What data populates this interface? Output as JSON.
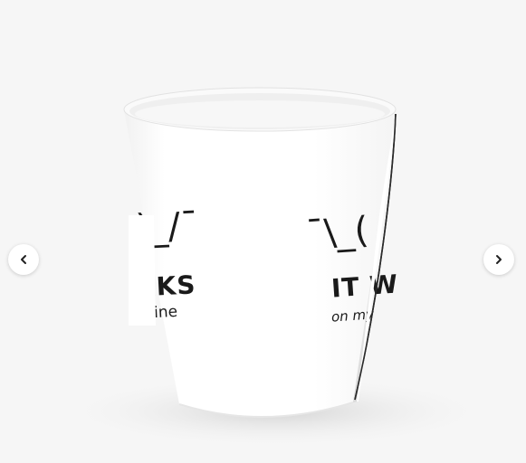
{
  "carousel": {
    "prev_icon": "chevron-left-icon",
    "next_icon": "chevron-right-icon"
  },
  "mug_print": {
    "left_face": ")_/¯",
    "left_line1": "RKS",
    "left_line2": "chine",
    "right_face": "¯\\_(",
    "right_line1": "IT W",
    "right_line2": "on my"
  },
  "colors": {
    "background": "#f6f6f6",
    "mug": "#ffffff",
    "ink": "#1a1a1a"
  }
}
